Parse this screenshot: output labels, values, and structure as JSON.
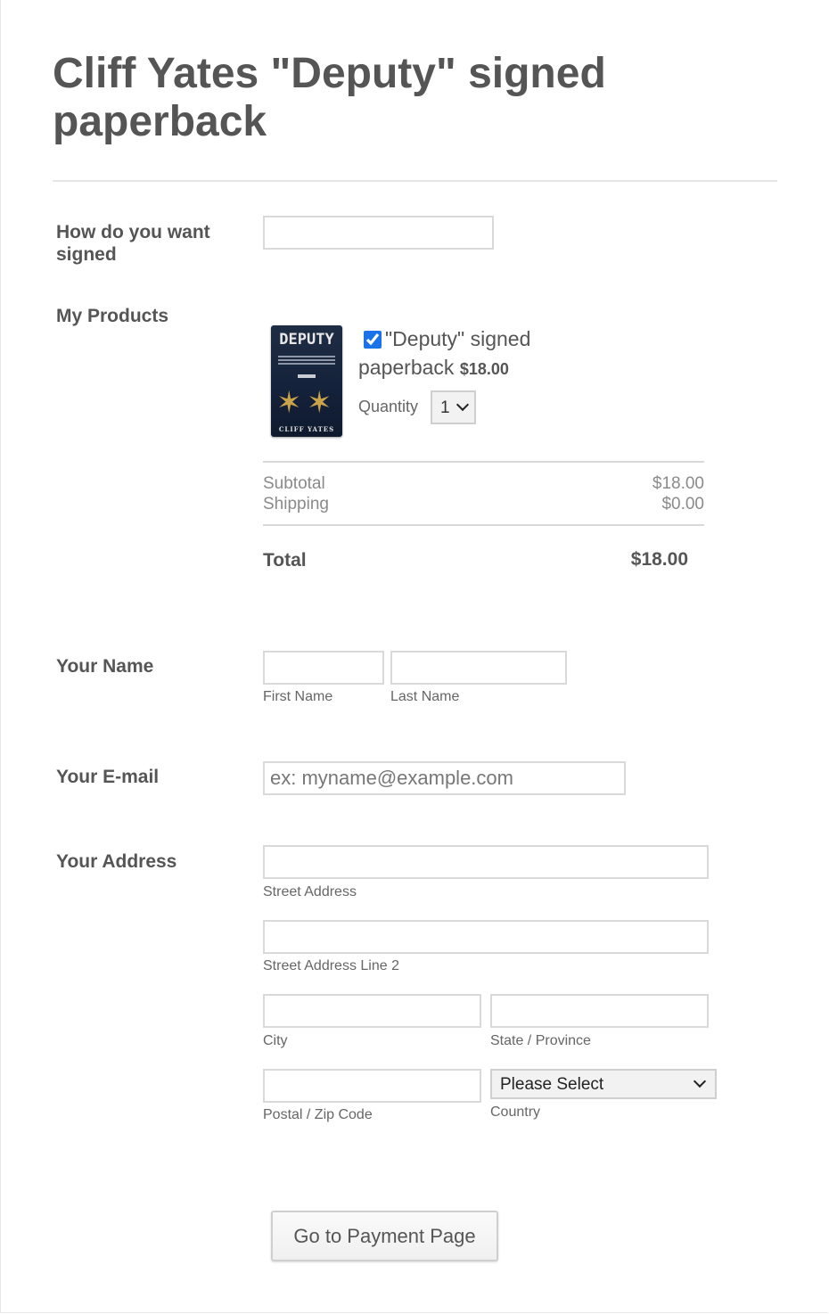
{
  "form_title": "Cliff Yates \"Deputy\" signed paperback",
  "signed_field": {
    "label": "How do you want signed",
    "value": ""
  },
  "products": {
    "label": "My Products",
    "item": {
      "cover_title": "DEPUTY",
      "cover_author": "CLIFF YATES",
      "checked": true,
      "name": "\"Deputy\" signed paperback",
      "price": "$18.00",
      "quantity_label": "Quantity",
      "quantity": "1"
    },
    "subtotal_label": "Subtotal",
    "subtotal": "$18.00",
    "shipping_label": "Shipping",
    "shipping": "$0.00",
    "total_label": "Total",
    "total": "$18.00"
  },
  "name_field": {
    "label": "Your Name",
    "first_sub": "First Name",
    "last_sub": "Last Name"
  },
  "email_field": {
    "label": "Your E-mail",
    "placeholder": "ex: myname@example.com"
  },
  "address": {
    "label": "Your Address",
    "street_sub": "Street Address",
    "street2_sub": "Street Address Line 2",
    "city_sub": "City",
    "state_sub": "State / Province",
    "zip_sub": "Postal / Zip Code",
    "country_sub": "Country",
    "country_value": "Please Select"
  },
  "submit_label": "Go to Payment Page"
}
